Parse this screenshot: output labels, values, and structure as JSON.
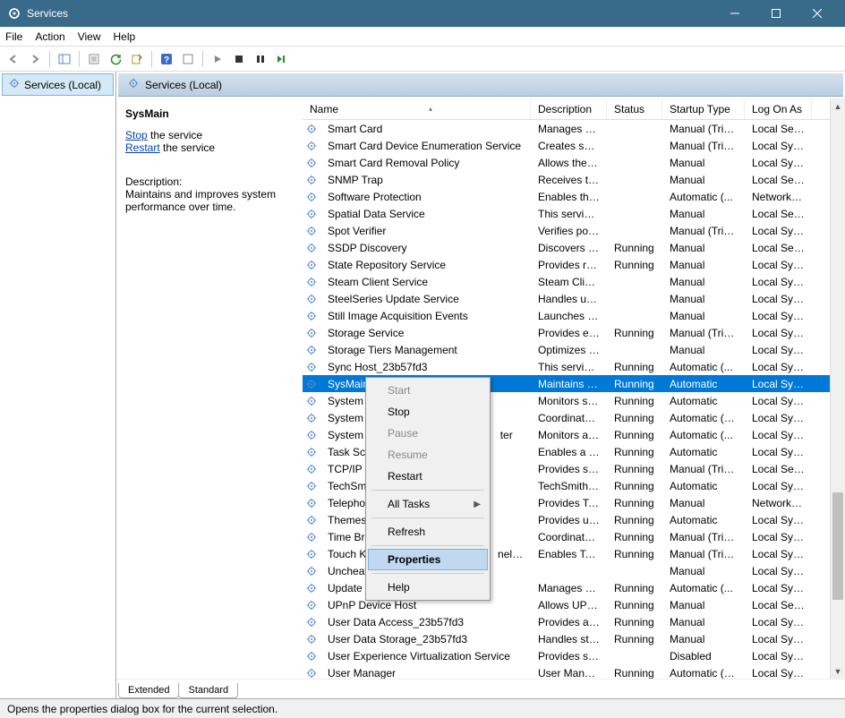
{
  "window": {
    "title": "Services"
  },
  "menubar": [
    "File",
    "Action",
    "View",
    "Help"
  ],
  "left_pane": {
    "item": "Services (Local)"
  },
  "pane_header": "Services (Local)",
  "detail": {
    "selected_name": "SysMain",
    "action_stop": "Stop",
    "action_stop_suffix": " the service",
    "action_restart": "Restart",
    "action_restart_suffix": " the service",
    "desc_label": "Description:",
    "desc_text": "Maintains and improves system performance over time."
  },
  "columns": [
    "Name",
    "Description",
    "Status",
    "Startup Type",
    "Log On As"
  ],
  "rows": [
    {
      "name": "Smart Card",
      "desc": "Manages ac...",
      "status": "",
      "startup": "Manual (Trig...",
      "logon": "Local Service"
    },
    {
      "name": "Smart Card Device Enumeration Service",
      "desc": "Creates soft...",
      "status": "",
      "startup": "Manual (Trig...",
      "logon": "Local Syste..."
    },
    {
      "name": "Smart Card Removal Policy",
      "desc": "Allows the s...",
      "status": "",
      "startup": "Manual",
      "logon": "Local Syste..."
    },
    {
      "name": "SNMP Trap",
      "desc": "Receives tra...",
      "status": "",
      "startup": "Manual",
      "logon": "Local Service"
    },
    {
      "name": "Software Protection",
      "desc": "Enables the ...",
      "status": "",
      "startup": "Automatic (...",
      "logon": "Network S..."
    },
    {
      "name": "Spatial Data Service",
      "desc": "This service ...",
      "status": "",
      "startup": "Manual",
      "logon": "Local Service"
    },
    {
      "name": "Spot Verifier",
      "desc": "Verifies pote...",
      "status": "",
      "startup": "Manual (Trig...",
      "logon": "Local Syste..."
    },
    {
      "name": "SSDP Discovery",
      "desc": "Discovers n...",
      "status": "Running",
      "startup": "Manual",
      "logon": "Local Service"
    },
    {
      "name": "State Repository Service",
      "desc": "Provides re...",
      "status": "Running",
      "startup": "Manual",
      "logon": "Local Syste..."
    },
    {
      "name": "Steam Client Service",
      "desc": "Steam Clien...",
      "status": "",
      "startup": "Manual",
      "logon": "Local Syste..."
    },
    {
      "name": "SteelSeries Update Service",
      "desc": "Handles up...",
      "status": "",
      "startup": "Manual",
      "logon": "Local Syste..."
    },
    {
      "name": "Still Image Acquisition Events",
      "desc": "Launches a...",
      "status": "",
      "startup": "Manual",
      "logon": "Local Syste..."
    },
    {
      "name": "Storage Service",
      "desc": "Provides en...",
      "status": "Running",
      "startup": "Manual (Trig...",
      "logon": "Local Syste..."
    },
    {
      "name": "Storage Tiers Management",
      "desc": "Optimizes t...",
      "status": "",
      "startup": "Manual",
      "logon": "Local Syste..."
    },
    {
      "name": "Sync Host_23b57fd3",
      "desc": "This service ...",
      "status": "Running",
      "startup": "Automatic (...",
      "logon": "Local Syste..."
    },
    {
      "name": "SysMain",
      "desc": "Maintains a...",
      "status": "Running",
      "startup": "Automatic",
      "logon": "Local Syste...",
      "selected": true
    },
    {
      "name": "System Event Notification",
      "desc": "Monitors sy...",
      "status": "Running",
      "startup": "Automatic",
      "logon": "Local Syste...",
      "trunc": "System E"
    },
    {
      "name": "System Events Broker",
      "desc": "Coordinates...",
      "status": "Running",
      "startup": "Automatic (T...",
      "logon": "Local Syste...",
      "trunc": "System E"
    },
    {
      "name": "System Guard",
      "desc": "Monitors an...",
      "status": "Running",
      "startup": "Automatic (...",
      "logon": "Local Syste...",
      "trunc": "System G",
      "suffix": "ter"
    },
    {
      "name": "Task Scheduler",
      "desc": "Enables a us...",
      "status": "Running",
      "startup": "Automatic",
      "logon": "Local Syste...",
      "trunc": "Task Sch"
    },
    {
      "name": "TCP/IP NetBIOS",
      "desc": "Provides su...",
      "status": "Running",
      "startup": "Manual (Trig...",
      "logon": "Local Service",
      "trunc": "TCP/IP N"
    },
    {
      "name": "TechSmith",
      "desc": "TechSmith ...",
      "status": "Running",
      "startup": "Automatic",
      "logon": "Local Syste...",
      "trunc": "TechSmi"
    },
    {
      "name": "Telephony",
      "desc": "Provides Tel...",
      "status": "Running",
      "startup": "Manual",
      "logon": "Network S...",
      "trunc": "Telephon"
    },
    {
      "name": "Themes",
      "desc": "Provides us...",
      "status": "Running",
      "startup": "Automatic",
      "logon": "Local Syste...",
      "trunc": "Themes "
    },
    {
      "name": "Time Broker",
      "desc": "Coordinates...",
      "status": "Running",
      "startup": "Manual (Trig...",
      "logon": "Local Syste...",
      "trunc": "Time Bro"
    },
    {
      "name": "Touch Keyboard",
      "desc": "Enables Tou...",
      "status": "Running",
      "startup": "Manual (Trig...",
      "logon": "Local Syste...",
      "trunc": "Touch Ke",
      "suffix": "nel Ser..."
    },
    {
      "name": "Uncheat",
      "desc": "",
      "status": "",
      "startup": "Manual",
      "logon": "Local Syste...",
      "trunc": "Uncheat"
    },
    {
      "name": "Update Orchestrator Service",
      "desc": "Manages W...",
      "status": "Running",
      "startup": "Automatic (...",
      "logon": "Local Syste..."
    },
    {
      "name": "UPnP Device Host",
      "desc": "Allows UPn...",
      "status": "Running",
      "startup": "Manual",
      "logon": "Local Service"
    },
    {
      "name": "User Data Access_23b57fd3",
      "desc": "Provides ap...",
      "status": "Running",
      "startup": "Manual",
      "logon": "Local Syste..."
    },
    {
      "name": "User Data Storage_23b57fd3",
      "desc": "Handles sto...",
      "status": "Running",
      "startup": "Manual",
      "logon": "Local Syste..."
    },
    {
      "name": "User Experience Virtualization Service",
      "desc": "Provides su...",
      "status": "",
      "startup": "Disabled",
      "logon": "Local Syste..."
    },
    {
      "name": "User Manager",
      "desc": "User Manag...",
      "status": "Running",
      "startup": "Automatic (T...",
      "logon": "Local Syste..."
    }
  ],
  "context_menu": {
    "start": "Start",
    "stop": "Stop",
    "pause": "Pause",
    "resume": "Resume",
    "restart": "Restart",
    "all_tasks": "All Tasks",
    "refresh": "Refresh",
    "properties": "Properties",
    "help": "Help"
  },
  "tabs": {
    "extended": "Extended",
    "standard": "Standard"
  },
  "statusbar": "Opens the properties dialog box for the current selection."
}
